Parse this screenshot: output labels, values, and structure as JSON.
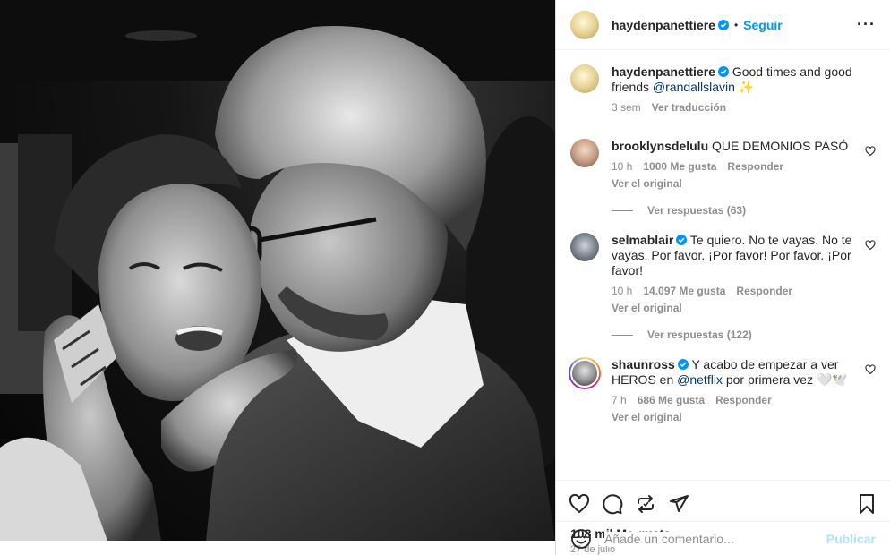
{
  "header": {
    "username": "haydenpanettiere",
    "dot": "•",
    "follow_label": "Seguir",
    "more_label": "···"
  },
  "caption": {
    "username": "haydenpanettiere",
    "text_before": " Good times and good friends ",
    "mention": "@randallslavin",
    "text_after": " ✨",
    "time": "3 sem",
    "translate_label": "Ver traducción"
  },
  "comments": [
    {
      "username": "brooklynsdelulu",
      "verified": false,
      "text": " QUE DEMONIOS PASÓ",
      "time": "10 h",
      "likes": "1000 Me gusta",
      "reply_label": "Responder",
      "see_original": "Ver el original",
      "replies_label": "Ver respuestas (63)"
    },
    {
      "username": "selmablair",
      "verified": true,
      "text": " Te quiero. No te vayas. No te vayas. Por favor. ¡Por favor! Por favor. ¡Por favor!",
      "time": "10 h",
      "likes": "14.097 Me gusta",
      "reply_label": "Responder",
      "see_original": "Ver el original",
      "replies_label": "Ver respuestas (122)"
    },
    {
      "username": "shaunross",
      "verified": true,
      "text_before": " Y acabo de empezar a ver HEROS en ",
      "mention": "@netflix",
      "text_after": " por primera vez 🤍🕊️",
      "time": "7 h",
      "likes": "686 Me gusta",
      "reply_label": "Responder",
      "see_original": "Ver el original"
    }
  ],
  "stats": {
    "likes": "108 mil Me gusta",
    "date": "27 de julio"
  },
  "add_comment": {
    "placeholder": "Añade un comentario...",
    "publish_label": "Publicar"
  },
  "icons": {
    "like": "heart-icon",
    "comment": "comment-icon",
    "share": "repost-icon",
    "send": "send-icon",
    "save": "bookmark-icon",
    "emoji": "emoji-icon",
    "verified": "verified-badge-icon"
  },
  "colors": {
    "link": "#0095f6",
    "mention": "#00376b",
    "muted": "#8e8e8e",
    "publish_disabled": "#b2dffc"
  }
}
